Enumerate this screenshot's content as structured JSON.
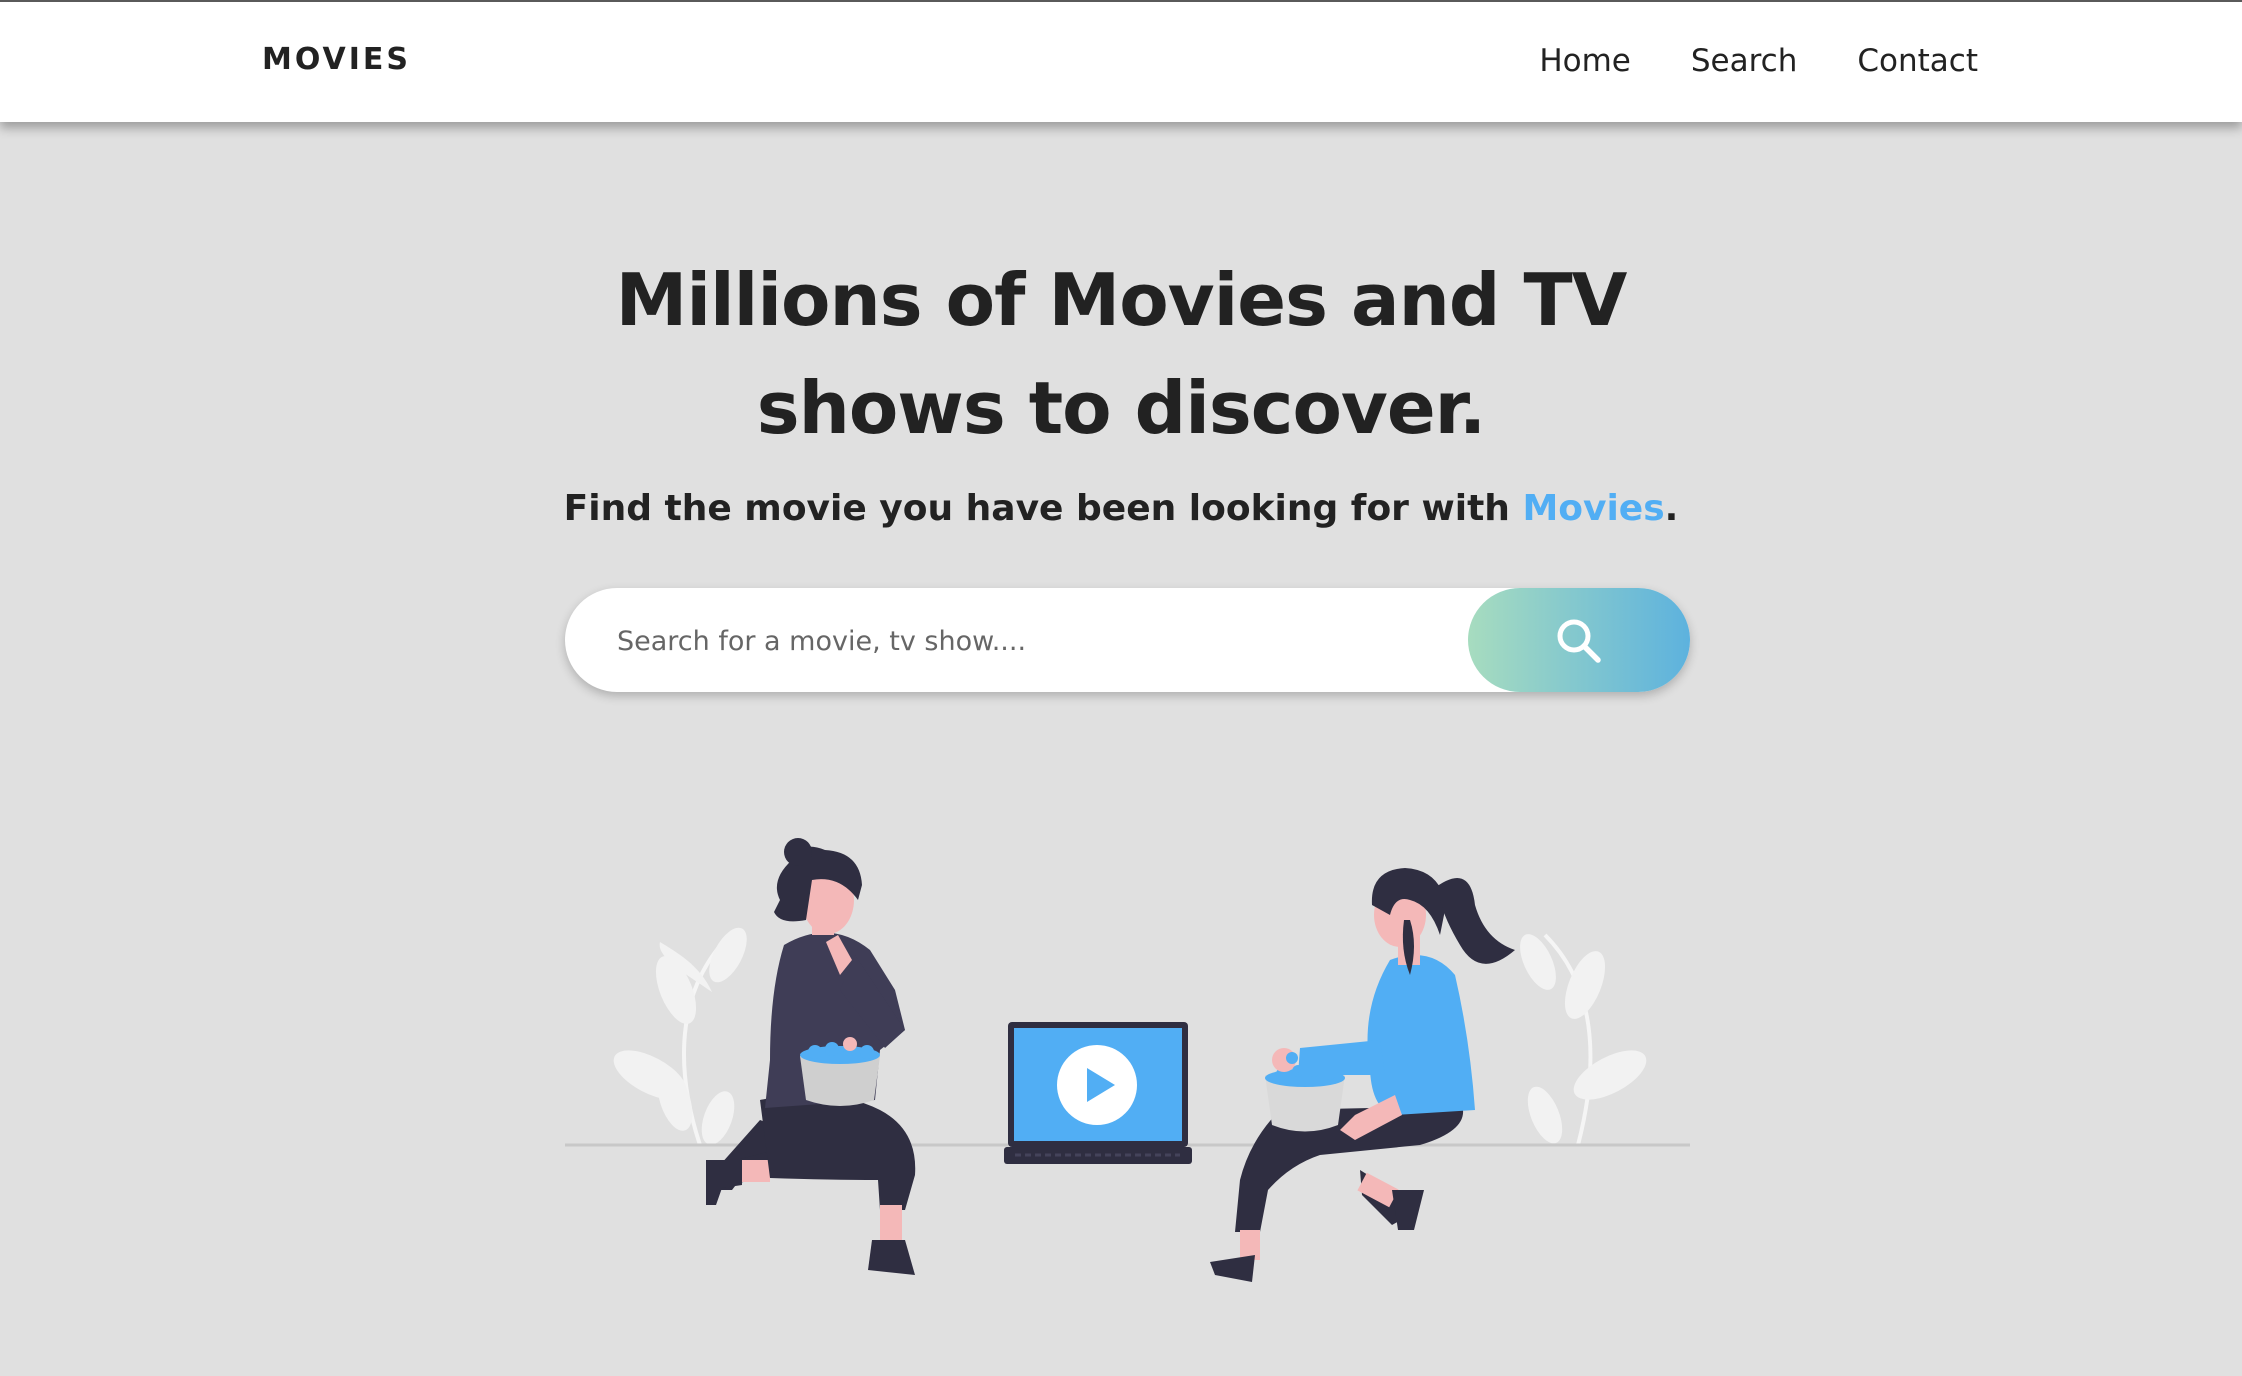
{
  "nav": {
    "brand": "MOVIES",
    "links": [
      "Home",
      "Search",
      "Contact"
    ]
  },
  "hero": {
    "title_line1": "Millions of Movies and TV",
    "title_line2": "shows to discover.",
    "subtitle_prefix": "Find the movie you have been looking for with ",
    "subtitle_accent": "Movies",
    "subtitle_suffix": "."
  },
  "search": {
    "placeholder": "Search for a movie, tv show....",
    "value": ""
  },
  "icons": {
    "search_button": "search-icon",
    "laptop_play": "play-icon"
  },
  "colors": {
    "accent": "#51aef4",
    "page_background": "#e0e0e0",
    "button_gradient_start": "#a7dcbf",
    "button_gradient_end": "#5db2de"
  }
}
